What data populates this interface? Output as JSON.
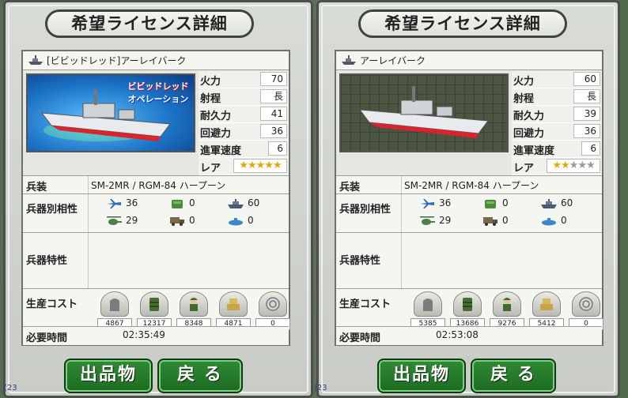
{
  "cards": [
    {
      "title": "希望ライセンス詳細",
      "name": "[ビビッドレッド]アーレイバーク",
      "banner_text": [
        "ビビッドレッド",
        "オペレーション"
      ],
      "stats": [
        {
          "label": "火力",
          "value": "70"
        },
        {
          "label": "射程",
          "value": "長"
        },
        {
          "label": "耐久力",
          "value": "41"
        },
        {
          "label": "回避力",
          "value": "36"
        },
        {
          "label": "進軍速度",
          "value": "6"
        }
      ],
      "rare_label": "レア",
      "rarity_filled": 5,
      "rarity_total": 5,
      "weapons_label": "兵装",
      "weapons": "SM-2MR / RGM-84 ハープーン",
      "affinity_label": "兵器別相性",
      "affinity": [
        {
          "icon": "aircraft-icon",
          "value": "36"
        },
        {
          "icon": "tank-icon",
          "value": "0"
        },
        {
          "icon": "ship-icon",
          "value": "60"
        },
        {
          "icon": "helicopter-icon",
          "value": "29"
        },
        {
          "icon": "truck-icon",
          "value": "0"
        },
        {
          "icon": "submarine-icon",
          "value": "0"
        }
      ],
      "traits_label": "兵器特性",
      "cost_label": "生産コスト",
      "costs": [
        {
          "icon": "steel-icon",
          "value": "4867"
        },
        {
          "icon": "fuel-icon",
          "value": "12317"
        },
        {
          "icon": "soldier-icon",
          "value": "8348"
        },
        {
          "icon": "supplies-icon",
          "value": "4871"
        },
        {
          "icon": "rare-metal-icon",
          "value": "0"
        }
      ],
      "time_label": "必要時間",
      "time": "02:35:49",
      "btn_market": "出品物",
      "btn_back": "戻 る",
      "corner": "(23"
    },
    {
      "title": "希望ライセンス詳細",
      "name": "アーレイバーク",
      "stats": [
        {
          "label": "火力",
          "value": "60"
        },
        {
          "label": "射程",
          "value": "長"
        },
        {
          "label": "耐久力",
          "value": "39"
        },
        {
          "label": "回避力",
          "value": "36"
        },
        {
          "label": "進軍速度",
          "value": "6"
        }
      ],
      "rare_label": "レア",
      "rarity_filled": 2,
      "rarity_total": 5,
      "weapons_label": "兵装",
      "weapons": "SM-2MR / RGM-84 ハープーン",
      "affinity_label": "兵器別相性",
      "affinity": [
        {
          "icon": "aircraft-icon",
          "value": "36"
        },
        {
          "icon": "tank-icon",
          "value": "0"
        },
        {
          "icon": "ship-icon",
          "value": "60"
        },
        {
          "icon": "helicopter-icon",
          "value": "29"
        },
        {
          "icon": "truck-icon",
          "value": "0"
        },
        {
          "icon": "submarine-icon",
          "value": "0"
        }
      ],
      "traits_label": "兵器特性",
      "cost_label": "生産コスト",
      "costs": [
        {
          "icon": "steel-icon",
          "value": "5385"
        },
        {
          "icon": "fuel-icon",
          "value": "13686"
        },
        {
          "icon": "soldier-icon",
          "value": "9276"
        },
        {
          "icon": "supplies-icon",
          "value": "5412"
        },
        {
          "icon": "rare-metal-icon",
          "value": "0"
        }
      ],
      "time_label": "必要時間",
      "time": "02:53:08",
      "btn_market": "出品物",
      "btn_back": "戻 る",
      "corner": "(23"
    }
  ],
  "colors": {
    "button_green": "#2f8a34",
    "star_gold": "#e7a70a",
    "panel": "#e5e7e1"
  }
}
